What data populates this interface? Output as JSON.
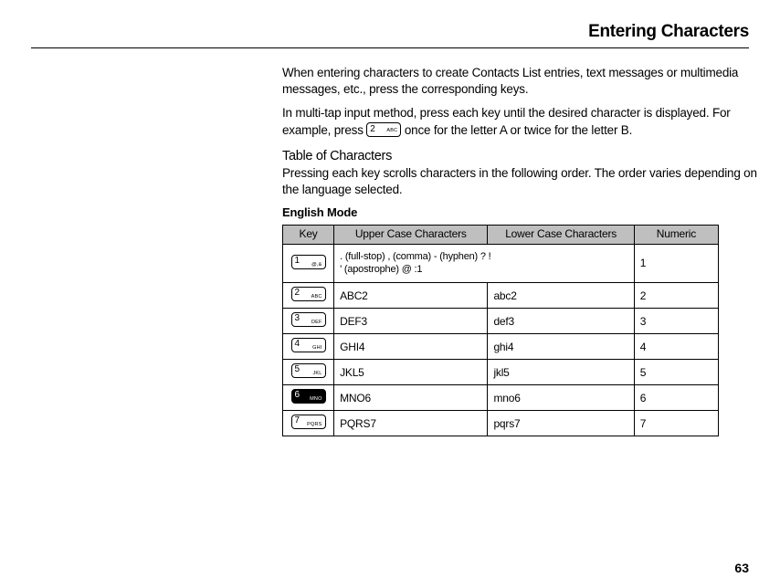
{
  "title": "Entering Characters",
  "intro1a": "When entering characters to create Contacts List entries, text messages or multimedia messages, etc., press the corresponding keys.",
  "intro2_pre": "In multi-tap input method, press each key until the desired character is displayed. For example, press ",
  "intro2_post": " once for the letter A or twice for the letter B.",
  "subhead1": "Table of Characters",
  "subhead1_desc": "Pressing each key scrolls characters in the following order. The order varies depending on the language selected.",
  "subhead2": "English Mode",
  "headers": {
    "key": "Key",
    "upper": "Upper Case Characters",
    "lower": "Lower Case Characters",
    "numeric": "Numeric"
  },
  "inline_key": {
    "digit": "2",
    "label": "ABC",
    "dark": false
  },
  "rows": [
    {
      "key_digit": "1",
      "key_label": "@,&",
      "dark": false,
      "upper_l1": ". (full-stop) , (comma) - (hyphen) ? !",
      "upper_l2": "' (apostrophe) @ :1",
      "lower": "",
      "numeric": "1",
      "span_upper": true
    },
    {
      "key_digit": "2",
      "key_label": "ABC",
      "dark": false,
      "upper": "ABC2",
      "lower": "abc2",
      "numeric": "2"
    },
    {
      "key_digit": "3",
      "key_label": "DEF",
      "dark": false,
      "upper": "DEF3",
      "lower": "def3",
      "numeric": "3"
    },
    {
      "key_digit": "4",
      "key_label": "GHI",
      "dark": false,
      "upper": "GHI4",
      "lower": "ghi4",
      "numeric": "4"
    },
    {
      "key_digit": "5",
      "key_label": "JKL",
      "dark": false,
      "upper": "JKL5",
      "lower": "jkl5",
      "numeric": "5"
    },
    {
      "key_digit": "6",
      "key_label": "MNO",
      "dark": true,
      "upper": "MNO6",
      "lower": "mno6",
      "numeric": "6"
    },
    {
      "key_digit": "7",
      "key_label": "PQRS",
      "dark": false,
      "upper": "PQRS7",
      "lower": "pqrs7",
      "numeric": "7"
    }
  ],
  "page_number": "63"
}
